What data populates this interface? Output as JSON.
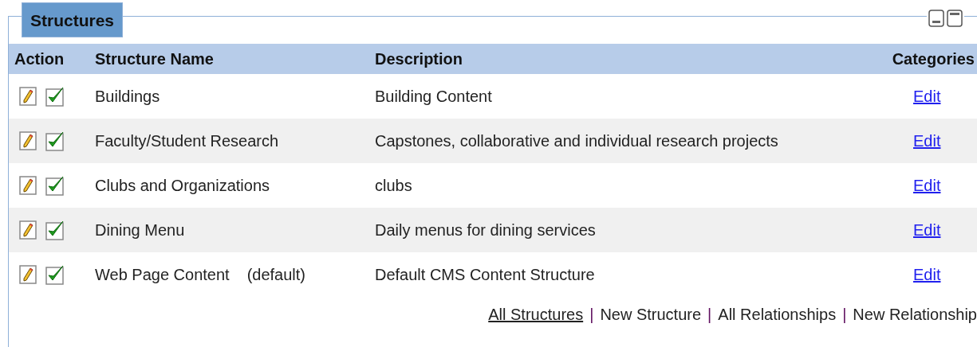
{
  "panel": {
    "title": "Structures"
  },
  "table": {
    "columns": [
      "Action",
      "Structure Name",
      "Description",
      "Categories"
    ],
    "rows": [
      {
        "name": "Buildings",
        "description": "Building Content",
        "categories": "Edit"
      },
      {
        "name": "Faculty/Student Research",
        "description": "Capstones, collaborative and individual research projects",
        "categories": "Edit"
      },
      {
        "name": "Clubs and Organizations",
        "description": "clubs",
        "categories": "Edit"
      },
      {
        "name": "Dining Menu",
        "description": "Daily menus for dining services",
        "categories": "Edit"
      },
      {
        "name": "Web Page Content",
        "badge": "(default)",
        "description": "Default CMS Content Structure",
        "categories": "Edit"
      }
    ]
  },
  "footer_links": [
    {
      "label": "All Structures",
      "selected": true
    },
    {
      "label": "New Structure",
      "selected": false
    },
    {
      "label": "All Relationships",
      "selected": false
    },
    {
      "label": "New Relationship",
      "selected": false
    }
  ],
  "separator": "|"
}
